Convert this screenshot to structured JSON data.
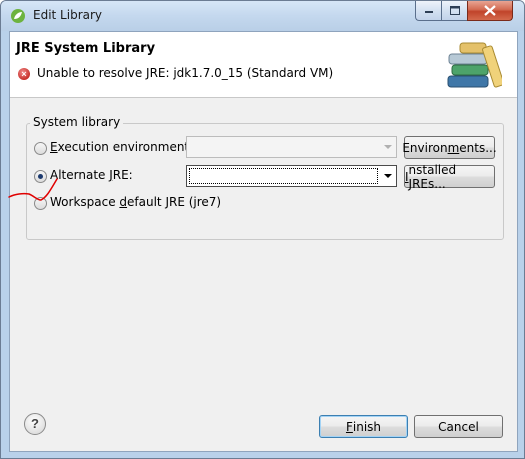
{
  "window": {
    "title": "Edit Library"
  },
  "header": {
    "title": "JRE System Library",
    "error_message": "Unable to resolve JRE: jdk1.7.0_15 (Standard VM)"
  },
  "system_library": {
    "group_label": "System library",
    "options": [
      {
        "label_pre": "",
        "mnemonic": "E",
        "label_post": "xecution environment:",
        "checked": false
      },
      {
        "label_pre": "Alternate ",
        "mnemonic": "J",
        "label_post": "RE:",
        "checked": true
      },
      {
        "label_pre": "Workspace ",
        "mnemonic": "d",
        "label_post": "efault JRE (jre7)",
        "checked": false
      }
    ],
    "execution_env_value": "",
    "alternate_jre_value": "",
    "environments_button": {
      "pre": "Environ",
      "mnemonic": "m",
      "post": "ents..."
    },
    "installed_jres_button": {
      "pre": "",
      "mnemonic": "I",
      "post": "nstalled JREs..."
    }
  },
  "footer": {
    "help_glyph": "?",
    "finish_button": {
      "pre": "",
      "mnemonic": "F",
      "post": "inish"
    },
    "cancel_button": "Cancel"
  },
  "icons": {
    "app": "eclipse-spring-icon",
    "error": "error-icon",
    "banner": "library-books-icon",
    "help": "help-icon",
    "annotation": "red-pen-mark"
  },
  "colors": {
    "titlebar": "#c4d8ee",
    "dialog_bg": "#f0f0f0",
    "error": "#c8302a",
    "annotation": "#e00000"
  }
}
